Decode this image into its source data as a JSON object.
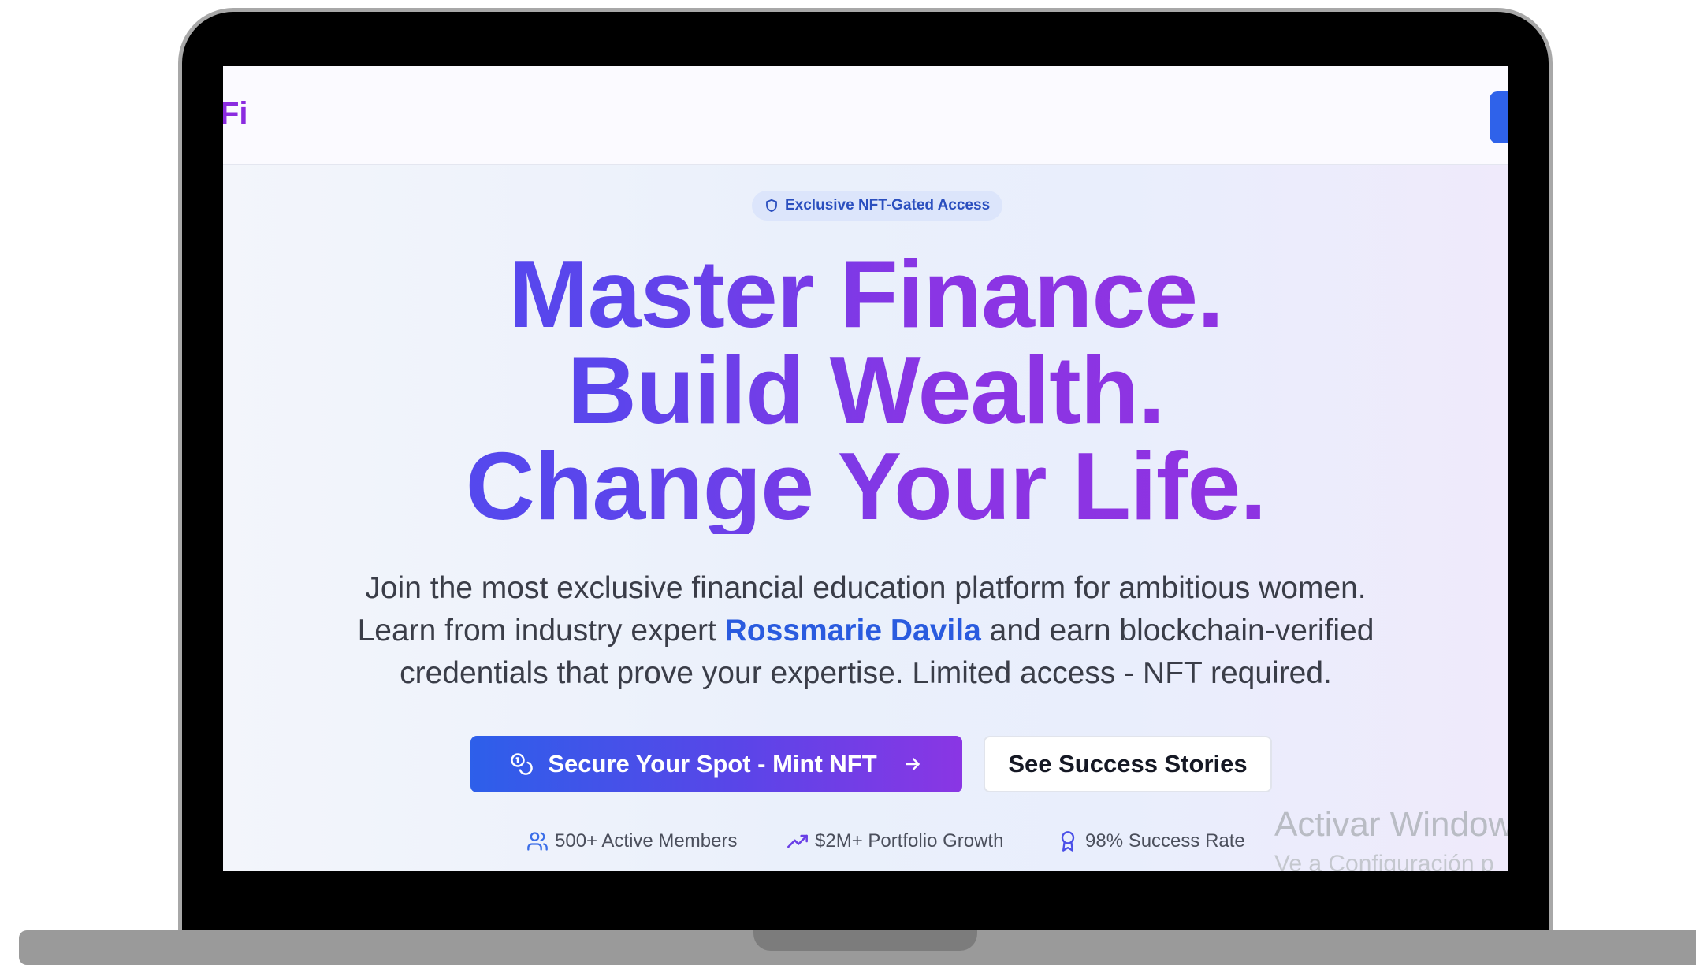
{
  "header": {
    "logo_fragment": "Fi"
  },
  "hero": {
    "badge_label": "Exclusive NFT-Gated Access",
    "headline": [
      "Master Finance.",
      "Build Wealth.",
      "Change Your Life."
    ],
    "subtext": {
      "part1": "Join the most exclusive financial education platform for ambitious women. Learn from industry expert ",
      "highlight": "Rossmarie Davila",
      "part2": " and earn blockchain-verified credentials that prove your expertise. Limited access - NFT required."
    },
    "primary_cta": "Secure Your Spot - Mint NFT",
    "secondary_cta": "See Success Stories",
    "stats": [
      {
        "icon": "users-icon",
        "label": "500+ Active Members"
      },
      {
        "icon": "trending-up-icon",
        "label": "$2M+ Portfolio Growth"
      },
      {
        "icon": "award-icon",
        "label": "98% Success Rate"
      }
    ]
  },
  "os_watermark": {
    "line1": "Activar Window",
    "line2": "Ve a Configuración p"
  },
  "colors": {
    "brand_purple": "#8b2be0",
    "brand_blue": "#2f62ea",
    "highlight_blue": "#2a5bdf"
  }
}
